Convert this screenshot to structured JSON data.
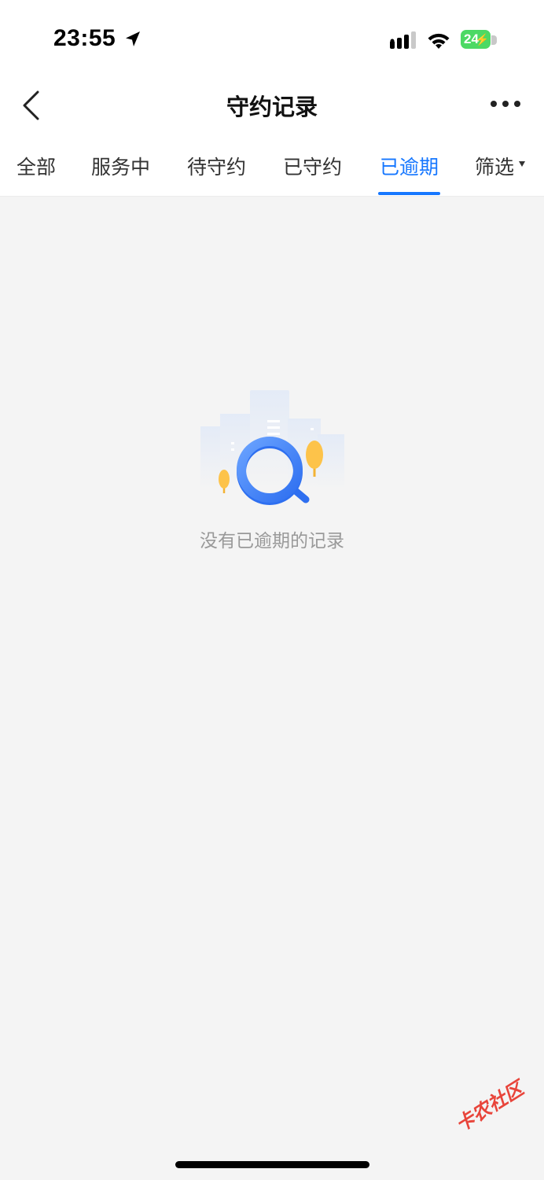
{
  "status_bar": {
    "time": "23:55",
    "battery": "24"
  },
  "nav": {
    "title": "守约记录"
  },
  "tabs": [
    {
      "label": "全部"
    },
    {
      "label": "服务中"
    },
    {
      "label": "待守约"
    },
    {
      "label": "已守约"
    },
    {
      "label": "已逾期",
      "active": true
    },
    {
      "label": "筛选"
    }
  ],
  "empty_state": {
    "message": "没有已逾期的记录"
  },
  "watermark": {
    "text": "卡农社区"
  },
  "colors": {
    "accent": "#1677ff",
    "background": "#f4f4f4",
    "battery": "#4cd964"
  }
}
